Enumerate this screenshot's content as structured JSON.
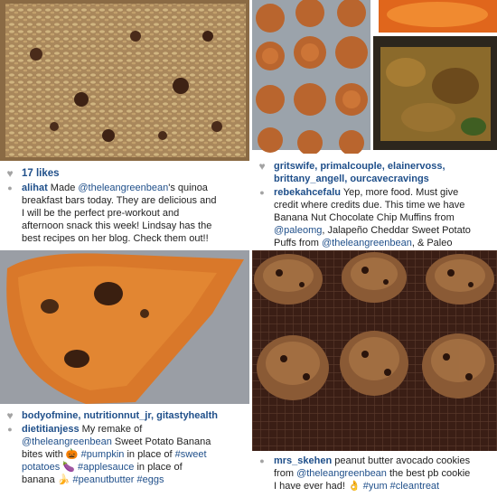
{
  "panels": {
    "p1": {
      "likes": "17 likes",
      "caption": {
        "user": "alihat",
        "l1a": "Made ",
        "l1m": "@theleangreenbean",
        "l1b": "'s quinoa",
        "l2": "breakfast bars today. They are delicious and",
        "l3": "I will be the perfect pre-workout and",
        "l4": "afternoon snack this week! Lindsay has the",
        "l5": "best recipes on her blog. Check them out!!"
      }
    },
    "p2": {
      "likers_line1": "gritswife, primalcouple, elainervoss,",
      "likers_line2": "brittany_angell, ourcavecravings",
      "caption": {
        "user": "rebekahcefalu",
        "l1": "Yep, more food. Must give",
        "l2": "credit where credits due. This time we have",
        "l3": "Banana Nut Chocolate Chip Muffins from",
        "l4m": "@paleomg",
        "l4": ", Jalapeño Cheddar Sweet Potato",
        "l5a": "Puffs from ",
        "l5m": "@theleangreenbean",
        "l5b": ", & Paleo"
      }
    },
    "p3": {
      "likers": "bodyofmine, nutritionnut_jr, gitastyhealth",
      "caption": {
        "user": "dietitianjess",
        "l1": "My remake of",
        "l2m": "@theleangreenbean",
        "l2": " Sweet Potato Banana",
        "l3a": "bites with ",
        "l3emo": "🎃",
        "l3t": " #pumpkin",
        "l3b": " in place of ",
        "l3t2": "#sweet",
        "l4t0": "potatoes",
        "l4emo": "🍆",
        "l4t": " #applesauce",
        "l4b": " in place of",
        "l5": "banana ",
        "l5emo": "🍌",
        "l5t": " #peanutbutter",
        "l5t2": " #eggs"
      }
    },
    "p4": {
      "caption": {
        "user": "mrs_skehen",
        "l1": "peanut butter avocado cookies",
        "l2a": "from ",
        "l2m": "@theleangreenbean",
        "l2b": " the best pb cookie",
        "l3": "I have ever had! ",
        "l3emo": "👌",
        "l3t": " #yum",
        "l3t2": " #cleantreat"
      }
    }
  },
  "icons": {
    "heart": "♥",
    "comment": "●"
  },
  "colors": {
    "link": "#1f4f8a",
    "icon_gray": "#a3a3a3"
  }
}
